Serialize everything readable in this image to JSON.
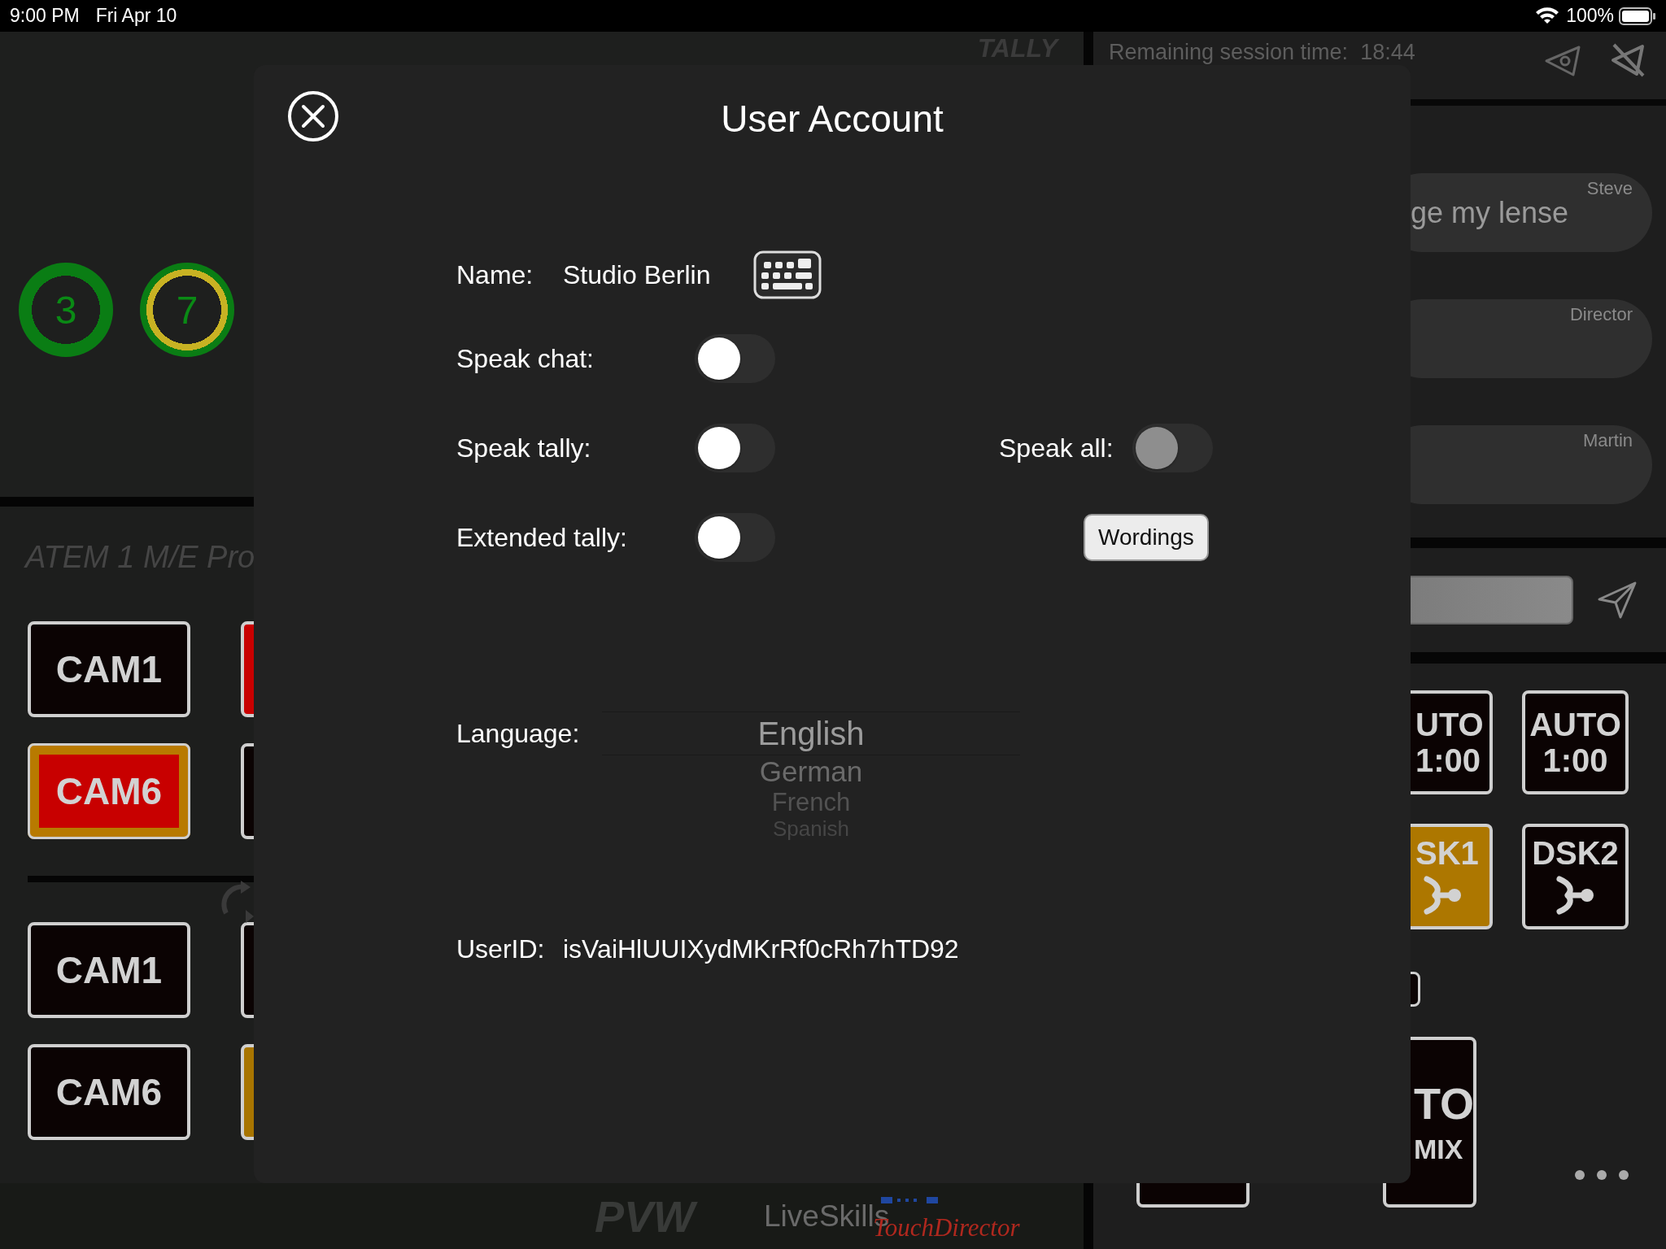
{
  "status_bar": {
    "time": "9:00 PM",
    "date": "Fri Apr 10",
    "battery": "100%"
  },
  "switcher": {
    "tally_label": "TALLY",
    "tally_lights": [
      {
        "number": "3",
        "color": "#0a7d14"
      },
      {
        "number": "7",
        "color": "#c8b223"
      }
    ],
    "device": "ATEM 1 M/E Pro",
    "bus_buttons": [
      {
        "label": "CAM1",
        "kind": "idle"
      },
      {
        "label": "CAM6",
        "kind": "program-preview"
      },
      {
        "label": "CAM1",
        "kind": "idle"
      },
      {
        "label": "CAM6",
        "kind": "idle"
      }
    ],
    "bus_buttons_cut": [
      {
        "kind": "program"
      },
      {
        "kind": "idle"
      },
      {
        "kind": "idle"
      },
      {
        "kind": "preview"
      }
    ],
    "bus": "PVW",
    "brand": "LiveSkills",
    "product": "TouchDirector"
  },
  "chat": {
    "session_time": "Remaining session time:  18:44",
    "messages": [
      {
        "sender": "Steve",
        "text": "ge my lense"
      },
      {
        "sender": "Director"
      },
      {
        "sender": "Martin"
      }
    ]
  },
  "controls": {
    "transitions": [
      {
        "label": "UTO",
        "rate": "1:00"
      },
      {
        "label": "AUTO",
        "rate": "1:00"
      }
    ],
    "keyers": [
      {
        "label": "SK1",
        "on": true
      },
      {
        "label": "DSK2",
        "on": false
      }
    ],
    "mix": {
      "label": "TO",
      "sub": "MIX"
    }
  },
  "dialog": {
    "title": "User Account",
    "name_label": "Name:",
    "name": "Studio Berlin",
    "settings": [
      {
        "label": "Speak chat:",
        "on": false,
        "disabled": false
      },
      {
        "label": "Speak tally:",
        "on": false,
        "disabled": false
      },
      {
        "label": "Speak all:",
        "on": false,
        "disabled": true
      },
      {
        "label": "Extended tally:",
        "on": false,
        "disabled": false
      }
    ],
    "wordings": "Wordings",
    "language_label": "Language:",
    "languages": [
      {
        "label": "English",
        "selected": true
      },
      {
        "label": "German",
        "selected": false
      },
      {
        "label": "French",
        "selected": false
      },
      {
        "label": "Spanish",
        "selected": false
      }
    ],
    "userid_label": "UserID:",
    "userid": "isVaiHlUUIXydMKrRf0cRh7hTD92"
  }
}
